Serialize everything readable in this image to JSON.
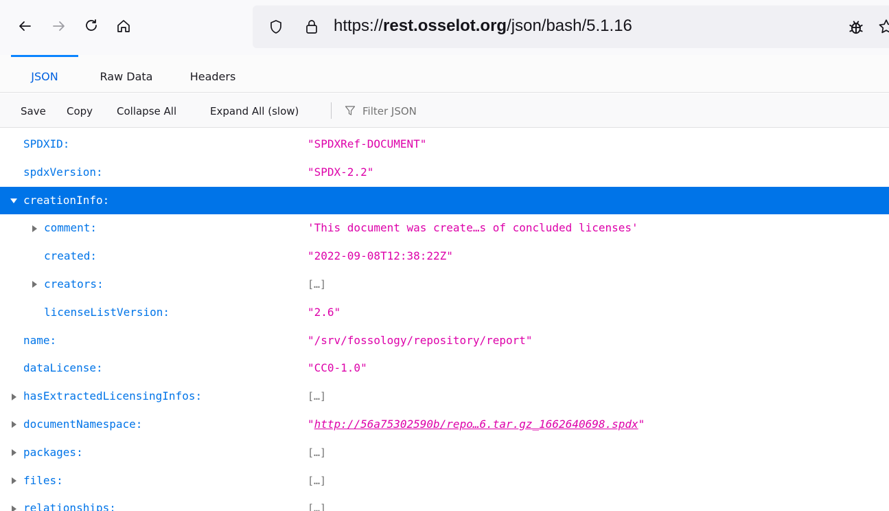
{
  "browser": {
    "url_scheme": "https://",
    "url_host": "rest.osselot.org",
    "url_path": "/json/bash/5.1.16"
  },
  "viewer": {
    "tabs": [
      {
        "label": "JSON",
        "active": true
      },
      {
        "label": "Raw Data",
        "active": false
      },
      {
        "label": "Headers",
        "active": false
      }
    ],
    "toolbar": {
      "save": "Save",
      "copy": "Copy",
      "collapse_all": "Collapse All",
      "expand_all": "Expand All (slow)",
      "filter_placeholder": "Filter JSON"
    }
  },
  "tree": [
    {
      "key": "SPDXID:",
      "value": "\"SPDXRef-DOCUMENT\"",
      "type": "string",
      "depth": 0,
      "toggle": "none"
    },
    {
      "key": "spdxVersion:",
      "value": "\"SPDX-2.2\"",
      "type": "string",
      "depth": 0,
      "toggle": "none"
    },
    {
      "key": "creationInfo:",
      "value": "",
      "type": "object",
      "depth": 0,
      "toggle": "expanded",
      "selected": true
    },
    {
      "key": "comment:",
      "value": "'This document was create…s of concluded licenses'",
      "type": "string",
      "depth": 1,
      "toggle": "collapsed"
    },
    {
      "key": "created:",
      "value": "\"2022-09-08T12:38:22Z\"",
      "type": "string",
      "depth": 1,
      "toggle": "none"
    },
    {
      "key": "creators:",
      "value": "[…]",
      "type": "array",
      "depth": 1,
      "toggle": "collapsed"
    },
    {
      "key": "licenseListVersion:",
      "value": "\"2.6\"",
      "type": "string",
      "depth": 1,
      "toggle": "none"
    },
    {
      "key": "name:",
      "value": "\"/srv/fossology/repository/report\"",
      "type": "string",
      "depth": 0,
      "toggle": "none"
    },
    {
      "key": "dataLicense:",
      "value": "\"CC0-1.0\"",
      "type": "string",
      "depth": 0,
      "toggle": "none"
    },
    {
      "key": "hasExtractedLicensingInfos:",
      "value": "[…]",
      "type": "array",
      "depth": 0,
      "toggle": "collapsed"
    },
    {
      "key": "documentNamespace:",
      "value": "http://56a75302590b/repo…6.tar.gz_1662640698.spdx",
      "type": "link",
      "depth": 0,
      "toggle": "collapsed"
    },
    {
      "key": "packages:",
      "value": "[…]",
      "type": "array",
      "depth": 0,
      "toggle": "collapsed"
    },
    {
      "key": "files:",
      "value": "[…]",
      "type": "array",
      "depth": 0,
      "toggle": "collapsed"
    },
    {
      "key": "relationships:",
      "value": "[…]",
      "type": "array",
      "depth": 0,
      "toggle": "collapsed"
    }
  ],
  "colors": {
    "key": "#0074e8",
    "string": "#dd00a9",
    "selected_row": "#0074e8",
    "active_tab": "#0061e0"
  }
}
